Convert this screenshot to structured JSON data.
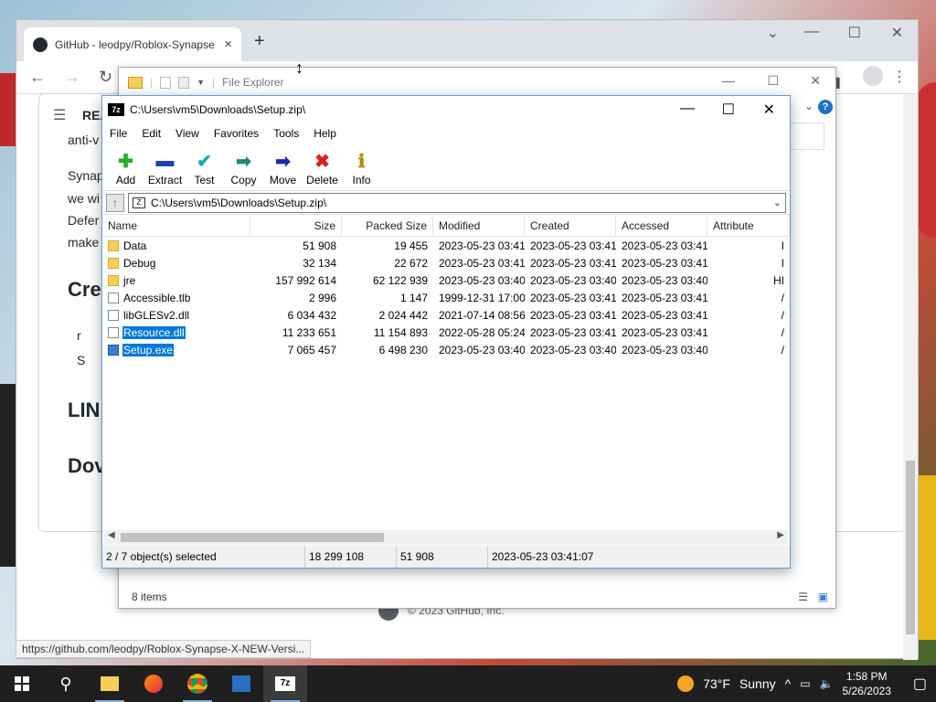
{
  "browser": {
    "tab_title": "GitHub - leodpy/Roblox-Synapse",
    "tab_close": "×",
    "new_tab": "+",
    "readme_label": "REA",
    "status_url": "https://github.com/leodpy/Roblox-Synapse-X-NEW-Versi...",
    "footer": "© 2023 GitHub, Inc.",
    "content_fragments": [
      "anti-v",
      "Synap",
      "we wi",
      "Defer",
      "make",
      "Cre",
      "r",
      "S",
      "LIN",
      "Dov"
    ]
  },
  "explorer": {
    "title": "File Explorer",
    "status": "8 items",
    "help": "?"
  },
  "sevenzip": {
    "title": "C:\\Users\\vm5\\Downloads\\Setup.zip\\",
    "app_icon": "7z",
    "menu": [
      "File",
      "Edit",
      "View",
      "Favorites",
      "Tools",
      "Help"
    ],
    "toolbar": [
      {
        "label": "Add",
        "icon": "add-icon"
      },
      {
        "label": "Extract",
        "icon": "extract-icon"
      },
      {
        "label": "Test",
        "icon": "test-icon"
      },
      {
        "label": "Copy",
        "icon": "copy-icon"
      },
      {
        "label": "Move",
        "icon": "move-icon"
      },
      {
        "label": "Delete",
        "icon": "delete-icon"
      },
      {
        "label": "Info",
        "icon": "info-icon"
      }
    ],
    "address": "C:\\Users\\vm5\\Downloads\\Setup.zip\\",
    "columns": [
      "Name",
      "Size",
      "Packed Size",
      "Modified",
      "Created",
      "Accessed",
      "Attribute"
    ],
    "rows": [
      {
        "name": "Data",
        "size": "51 908",
        "packed": "19 455",
        "modified": "2023-05-23 03:41",
        "created": "2023-05-23 03:41",
        "accessed": "2023-05-23 03:41",
        "attr": "I",
        "type": "folder",
        "selected": false
      },
      {
        "name": "Debug",
        "size": "32 134",
        "packed": "22 672",
        "modified": "2023-05-23 03:41",
        "created": "2023-05-23 03:41",
        "accessed": "2023-05-23 03:41",
        "attr": "I",
        "type": "folder",
        "selected": false
      },
      {
        "name": "jre",
        "size": "157 992 614",
        "packed": "62 122 939",
        "modified": "2023-05-23 03:40",
        "created": "2023-05-23 03:40",
        "accessed": "2023-05-23 03:40",
        "attr": "HI",
        "type": "folder",
        "selected": false
      },
      {
        "name": "Accessible.tlb",
        "size": "2 996",
        "packed": "1 147",
        "modified": "1999-12-31 17:00",
        "created": "2023-05-23 03:41",
        "accessed": "2023-05-23 03:41",
        "attr": "/",
        "type": "file",
        "selected": false
      },
      {
        "name": "libGLESv2.dll",
        "size": "6 034 432",
        "packed": "2 024 442",
        "modified": "2021-07-14 08:56",
        "created": "2023-05-23 03:41",
        "accessed": "2023-05-23 03:41",
        "attr": "/",
        "type": "file",
        "selected": false
      },
      {
        "name": "Resource.dll",
        "size": "11 233 651",
        "packed": "11 154 893",
        "modified": "2022-05-28 05:24",
        "created": "2023-05-23 03:41",
        "accessed": "2023-05-23 03:41",
        "attr": "/",
        "type": "file",
        "selected": true
      },
      {
        "name": "Setup.exe",
        "size": "7 065 457",
        "packed": "6 498 230",
        "modified": "2023-05-23 03:40",
        "created": "2023-05-23 03:40",
        "accessed": "2023-05-23 03:40",
        "attr": "/",
        "type": "exe",
        "selected": true
      }
    ],
    "status": {
      "selection": "2 / 7 object(s) selected",
      "size": "18 299 108",
      "packed": "51 908",
      "date": "2023-05-23 03:41:07"
    }
  },
  "taskbar": {
    "weather_temp": "73°F",
    "weather_cond": "Sunny",
    "time": "1:58 PM",
    "date": "5/26/2023",
    "active_app": "7z"
  },
  "colors": {
    "selection": "#0078d7",
    "taskbar": "#1f1f1f"
  }
}
